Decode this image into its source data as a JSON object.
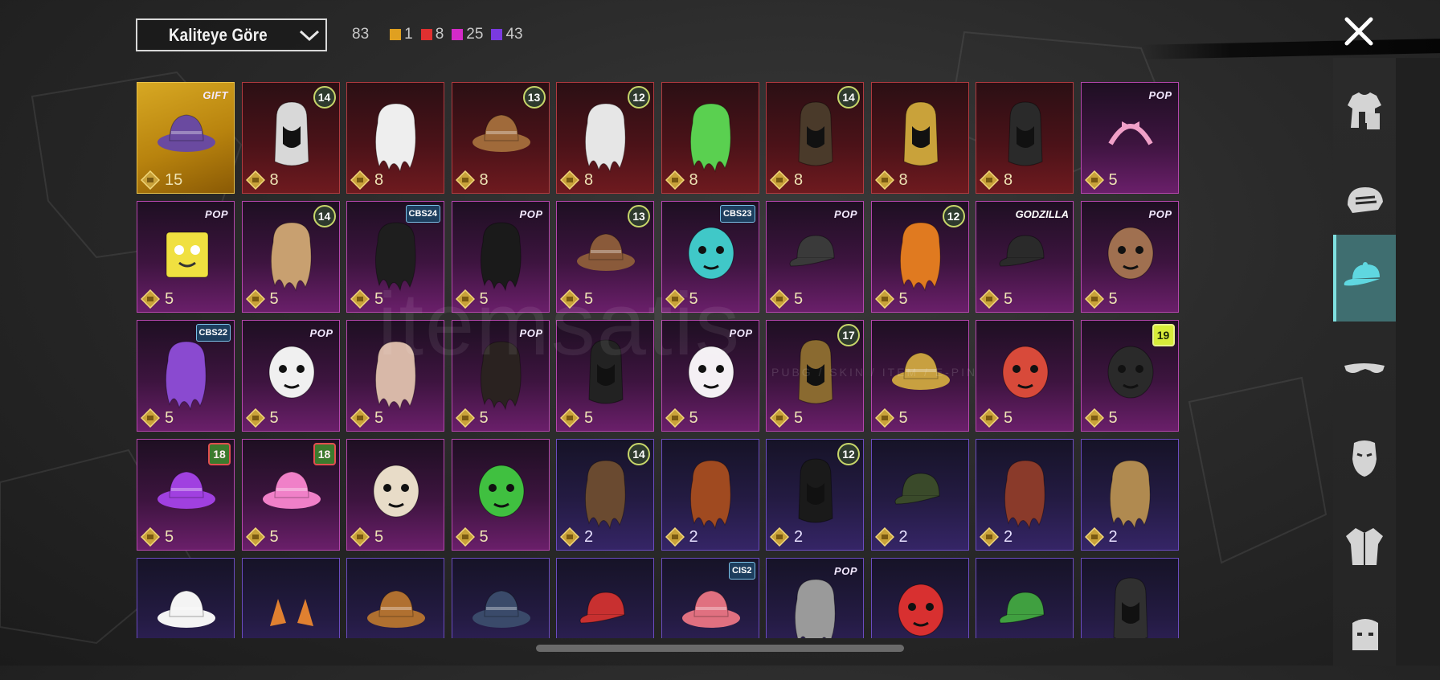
{
  "header": {
    "sort_label": "Kaliteye Göre",
    "total_count": "83",
    "quality_counts": [
      {
        "color": "#e0a020",
        "count": "1"
      },
      {
        "color": "#e03030",
        "count": "8"
      },
      {
        "color": "#d42ac8",
        "count": "25"
      },
      {
        "color": "#7a3ae0",
        "count": "43"
      }
    ]
  },
  "watermark": {
    "text": "itemsatis",
    "sub": "PUBG / SKIN / ITEM / E-PIN"
  },
  "sidebar": {
    "tabs": [
      {
        "name": "outfit-tab",
        "icon": "outfit-icon",
        "active": false
      },
      {
        "name": "helmet-tab",
        "icon": "helmet-icon",
        "active": false
      },
      {
        "name": "hat-tab",
        "icon": "cap-icon",
        "active": true
      },
      {
        "name": "glasses-tab",
        "icon": "glasses-icon",
        "active": false
      },
      {
        "name": "mask-tab",
        "icon": "mask-icon",
        "active": false
      },
      {
        "name": "jacket-tab",
        "icon": "jacket-icon",
        "active": false
      },
      {
        "name": "backpack-tab",
        "icon": "face-icon",
        "active": false
      }
    ]
  },
  "items": [
    {
      "r": "gold",
      "b": "GIFT",
      "bt": "pop",
      "p": "15",
      "c": "#6a4aa0",
      "a": "hat"
    },
    {
      "r": "red",
      "b": "14",
      "bt": "lvl",
      "p": "8",
      "c": "#d8d8d8",
      "a": "hood"
    },
    {
      "r": "red",
      "b": "",
      "bt": "",
      "p": "8",
      "c": "#eeeeee",
      "a": "hair"
    },
    {
      "r": "red",
      "b": "13",
      "bt": "lvl",
      "p": "8",
      "c": "#a06a3a",
      "a": "hat"
    },
    {
      "r": "red",
      "b": "12",
      "bt": "lvl",
      "p": "8",
      "c": "#e6e6e6",
      "a": "hair"
    },
    {
      "r": "red",
      "b": "",
      "bt": "",
      "p": "8",
      "c": "#5ad050",
      "a": "hair"
    },
    {
      "r": "red",
      "b": "14",
      "bt": "lvl",
      "p": "8",
      "c": "#4a3a2a",
      "a": "hood"
    },
    {
      "r": "red",
      "b": "",
      "bt": "",
      "p": "8",
      "c": "#c9a23a",
      "a": "hood"
    },
    {
      "r": "red",
      "b": "",
      "bt": "",
      "p": "8",
      "c": "#2a2a2a",
      "a": "hood"
    },
    {
      "r": "pink",
      "b": "POP",
      "bt": "pop",
      "p": "5",
      "c": "#f0a0c8",
      "a": "band"
    },
    {
      "r": "pink",
      "b": "POP",
      "bt": "pop",
      "p": "5",
      "c": "#f0e040",
      "a": "box"
    },
    {
      "r": "pink",
      "b": "14",
      "bt": "lvl",
      "p": "5",
      "c": "#c8a070",
      "a": "hair"
    },
    {
      "r": "pink",
      "b": "CBS24",
      "bt": "text",
      "p": "5",
      "c": "#1e1e1e",
      "a": "hair"
    },
    {
      "r": "pink",
      "b": "POP",
      "bt": "pop",
      "p": "5",
      "c": "#1a1a1a",
      "a": "hair"
    },
    {
      "r": "pink",
      "b": "13",
      "bt": "lvl",
      "p": "5",
      "c": "#8a5a3a",
      "a": "hat"
    },
    {
      "r": "pink",
      "b": "CBS23",
      "bt": "text",
      "p": "5",
      "c": "#40c8c8",
      "a": "head"
    },
    {
      "r": "pink",
      "b": "POP",
      "bt": "pop",
      "p": "5",
      "c": "#3a3a3a",
      "a": "cap"
    },
    {
      "r": "pink",
      "b": "12",
      "bt": "lvl",
      "p": "5",
      "c": "#e07a20",
      "a": "hair"
    },
    {
      "r": "pink",
      "b": "GODZILLA",
      "bt": "gz",
      "p": "5",
      "c": "#2a2a2a",
      "a": "cap"
    },
    {
      "r": "pink",
      "b": "POP",
      "bt": "pop",
      "p": "5",
      "c": "#a07050",
      "a": "head"
    },
    {
      "r": "pink",
      "b": "CBS22",
      "bt": "text",
      "p": "5",
      "c": "#8a4ad0",
      "a": "hair"
    },
    {
      "r": "pink",
      "b": "POP",
      "bt": "pop",
      "p": "5",
      "c": "#f0f0f0",
      "a": "head"
    },
    {
      "r": "pink",
      "b": "",
      "bt": "",
      "p": "5",
      "c": "#d8b8a8",
      "a": "hair"
    },
    {
      "r": "pink",
      "b": "POP",
      "bt": "pop",
      "p": "5",
      "c": "#2a2220",
      "a": "hair"
    },
    {
      "r": "pink",
      "b": "",
      "bt": "",
      "p": "5",
      "c": "#222222",
      "a": "hood"
    },
    {
      "r": "pink",
      "b": "POP",
      "bt": "pop",
      "p": "5",
      "c": "#f4f0f4",
      "a": "head"
    },
    {
      "r": "pink",
      "b": "17",
      "bt": "lvl",
      "p": "5",
      "c": "#8a6a30",
      "a": "hood"
    },
    {
      "r": "pink",
      "b": "",
      "bt": "",
      "p": "5",
      "c": "#c8a040",
      "a": "hat"
    },
    {
      "r": "pink",
      "b": "",
      "bt": "",
      "p": "5",
      "c": "#d84a3a",
      "a": "head"
    },
    {
      "r": "pink",
      "b": "19",
      "bt": "lvl y",
      "p": "5",
      "c": "#2a2a2a",
      "a": "head"
    },
    {
      "r": "pink",
      "b": "18",
      "bt": "lvl r",
      "p": "5",
      "c": "#a040e0",
      "a": "hat"
    },
    {
      "r": "pink",
      "b": "18",
      "bt": "lvl r",
      "p": "5",
      "c": "#f080c8",
      "a": "hat"
    },
    {
      "r": "pink",
      "b": "",
      "bt": "",
      "p": "5",
      "c": "#e8dcc8",
      "a": "head"
    },
    {
      "r": "pink",
      "b": "",
      "bt": "",
      "p": "5",
      "c": "#40c040",
      "a": "head"
    },
    {
      "r": "purple",
      "b": "14",
      "bt": "lvl",
      "p": "2",
      "c": "#6a4a30",
      "a": "hair"
    },
    {
      "r": "purple",
      "b": "",
      "bt": "",
      "p": "2",
      "c": "#a04a20",
      "a": "hair"
    },
    {
      "r": "purple",
      "b": "12",
      "bt": "lvl",
      "p": "2",
      "c": "#1a1a1a",
      "a": "hood"
    },
    {
      "r": "purple",
      "b": "",
      "bt": "",
      "p": "2",
      "c": "#3a4a2a",
      "a": "cap"
    },
    {
      "r": "purple",
      "b": "",
      "bt": "",
      "p": "2",
      "c": "#8a3a2a",
      "a": "hair"
    },
    {
      "r": "purple",
      "b": "",
      "bt": "",
      "p": "2",
      "c": "#b08a50",
      "a": "hair"
    },
    {
      "r": "purple",
      "b": "",
      "bt": "",
      "p": "",
      "c": "#f4f4f4",
      "a": "hat"
    },
    {
      "r": "purple",
      "b": "",
      "bt": "",
      "p": "",
      "c": "#e08030",
      "a": "ears"
    },
    {
      "r": "purple",
      "b": "",
      "bt": "",
      "p": "",
      "c": "#b07030",
      "a": "hat"
    },
    {
      "r": "purple",
      "b": "",
      "bt": "",
      "p": "",
      "c": "#3a4a6a",
      "a": "hat"
    },
    {
      "r": "purple",
      "b": "",
      "bt": "",
      "p": "",
      "c": "#c83030",
      "a": "cap"
    },
    {
      "r": "purple",
      "b": "CIS2",
      "bt": "text",
      "p": "",
      "c": "#e07080",
      "a": "hat"
    },
    {
      "r": "purple",
      "b": "POP",
      "bt": "pop",
      "p": "",
      "c": "#9a9a9a",
      "a": "hair"
    },
    {
      "r": "purple",
      "b": "",
      "bt": "",
      "p": "",
      "c": "#d83030",
      "a": "head"
    },
    {
      "r": "purple",
      "b": "",
      "bt": "",
      "p": "",
      "c": "#40a040",
      "a": "cap"
    },
    {
      "r": "purple",
      "b": "",
      "bt": "",
      "p": "",
      "c": "#303030",
      "a": "hood"
    }
  ]
}
